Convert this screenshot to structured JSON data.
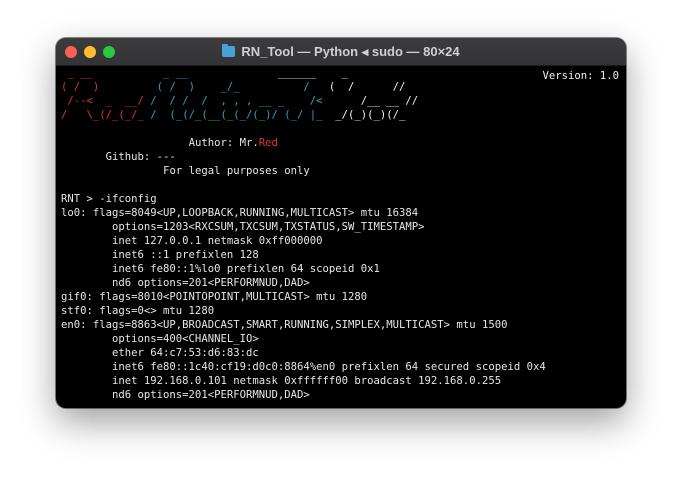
{
  "window": {
    "title": "RN_Tool — Python ◂ sudo — 80×24"
  },
  "banner": {
    "version": "Version: 1.0",
    "logo_lines": [
      {
        "red": " _ __",
        "cyan": "           _ __",
        "white": "              ______    _"
      },
      {
        "red": "( /  )",
        "cyan": "         ( /  )    _/_          /",
        "white": "   (  /      //"
      },
      {
        "red": " /--<  _  __/",
        "cyan": " /  / /  /  , , , __ _    /<",
        "white": "      /__ __ //"
      },
      {
        "red": "/   \\_(/_(_/_",
        "cyan": " /  (_(/_(__(_(_/(_)/ (_/ |_",
        "white": "  _/(_)(_)(/_"
      }
    ],
    "author_label": "Author: Mr.",
    "author_name": "Red",
    "github_line": "Github: ---",
    "legal_line": "For legal purposes only"
  },
  "terminal": {
    "prompt": "RNT > ",
    "command": "-ifconfig",
    "output": [
      "lo0: flags=8049<UP,LOOPBACK,RUNNING,MULTICAST> mtu 16384",
      "        options=1203<RXCSUM,TXCSUM,TXSTATUS,SW_TIMESTAMP>",
      "        inet 127.0.0.1 netmask 0xff000000",
      "        inet6 ::1 prefixlen 128",
      "        inet6 fe80::1%lo0 prefixlen 64 scopeid 0x1",
      "        nd6 options=201<PERFORMNUD,DAD>",
      "gif0: flags=8010<POINTOPOINT,MULTICAST> mtu 1280",
      "stf0: flags=0<> mtu 1280",
      "en0: flags=8863<UP,BROADCAST,SMART,RUNNING,SIMPLEX,MULTICAST> mtu 1500",
      "        options=400<CHANNEL_IO>",
      "        ether 64:c7:53:d6:83:dc",
      "        inet6 fe80::1c40:cf19:d0c0:8864%en0 prefixlen 64 secured scopeid 0x4",
      "        inet 192.168.0.101 netmask 0xffffff00 broadcast 192.168.0.255",
      "        nd6 options=201<PERFORMNUD,DAD>"
    ]
  }
}
